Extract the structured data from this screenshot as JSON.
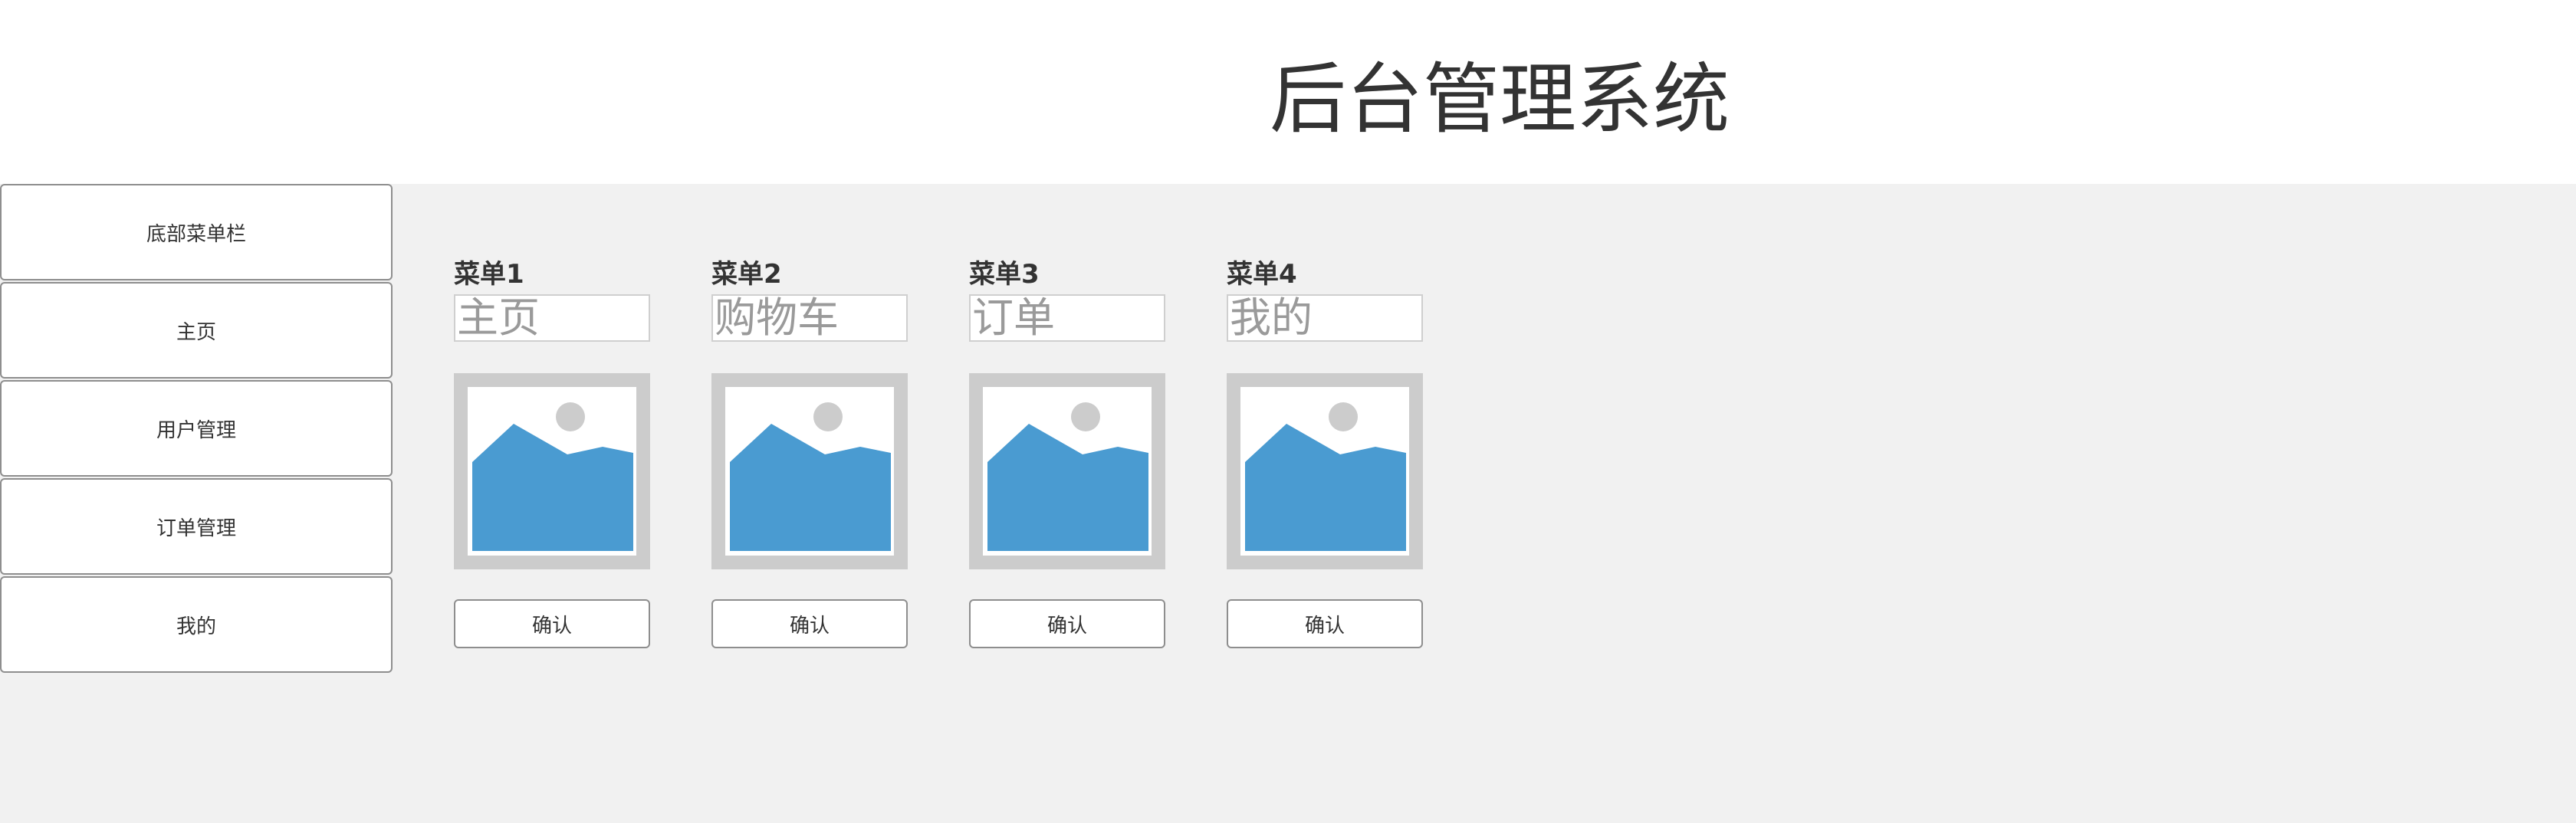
{
  "header": {
    "title": "后台管理系统"
  },
  "sidebar": {
    "items": [
      {
        "label": "底部菜单栏"
      },
      {
        "label": "主页"
      },
      {
        "label": "用户管理"
      },
      {
        "label": "订单管理"
      },
      {
        "label": "我的"
      }
    ]
  },
  "cards": [
    {
      "title": "菜单1",
      "input_value": "主页",
      "image_icon": "image-placeholder-icon",
      "button_label": "确认"
    },
    {
      "title": "菜单2",
      "input_value": "购物车",
      "image_icon": "image-placeholder-icon",
      "button_label": "确认"
    },
    {
      "title": "菜单3",
      "input_value": "订单",
      "image_icon": "image-placeholder-icon",
      "button_label": "确认"
    },
    {
      "title": "菜单4",
      "input_value": "我的",
      "image_icon": "image-placeholder-icon",
      "button_label": "确认"
    }
  ],
  "colors": {
    "header_bg": "#ffffff",
    "page_bg": "#f1f1f1",
    "image_frame": "#cccccc",
    "image_mountain": "#4a9bd1",
    "image_sun": "#cccccc"
  }
}
